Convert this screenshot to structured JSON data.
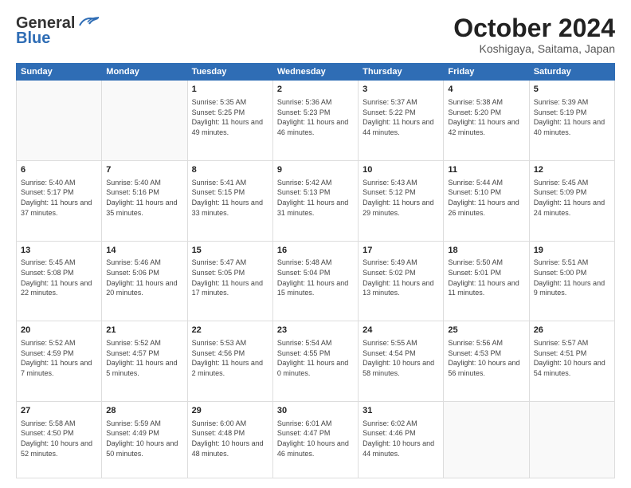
{
  "logo": {
    "line1": "General",
    "line2": "Blue"
  },
  "title": "October 2024",
  "location": "Koshigaya, Saitama, Japan",
  "days_of_week": [
    "Sunday",
    "Monday",
    "Tuesday",
    "Wednesday",
    "Thursday",
    "Friday",
    "Saturday"
  ],
  "weeks": [
    [
      {
        "day": "",
        "detail": ""
      },
      {
        "day": "",
        "detail": ""
      },
      {
        "day": "1",
        "detail": "Sunrise: 5:35 AM\nSunset: 5:25 PM\nDaylight: 11 hours\nand 49 minutes."
      },
      {
        "day": "2",
        "detail": "Sunrise: 5:36 AM\nSunset: 5:23 PM\nDaylight: 11 hours\nand 46 minutes."
      },
      {
        "day": "3",
        "detail": "Sunrise: 5:37 AM\nSunset: 5:22 PM\nDaylight: 11 hours\nand 44 minutes."
      },
      {
        "day": "4",
        "detail": "Sunrise: 5:38 AM\nSunset: 5:20 PM\nDaylight: 11 hours\nand 42 minutes."
      },
      {
        "day": "5",
        "detail": "Sunrise: 5:39 AM\nSunset: 5:19 PM\nDaylight: 11 hours\nand 40 minutes."
      }
    ],
    [
      {
        "day": "6",
        "detail": "Sunrise: 5:40 AM\nSunset: 5:17 PM\nDaylight: 11 hours\nand 37 minutes."
      },
      {
        "day": "7",
        "detail": "Sunrise: 5:40 AM\nSunset: 5:16 PM\nDaylight: 11 hours\nand 35 minutes."
      },
      {
        "day": "8",
        "detail": "Sunrise: 5:41 AM\nSunset: 5:15 PM\nDaylight: 11 hours\nand 33 minutes."
      },
      {
        "day": "9",
        "detail": "Sunrise: 5:42 AM\nSunset: 5:13 PM\nDaylight: 11 hours\nand 31 minutes."
      },
      {
        "day": "10",
        "detail": "Sunrise: 5:43 AM\nSunset: 5:12 PM\nDaylight: 11 hours\nand 29 minutes."
      },
      {
        "day": "11",
        "detail": "Sunrise: 5:44 AM\nSunset: 5:10 PM\nDaylight: 11 hours\nand 26 minutes."
      },
      {
        "day": "12",
        "detail": "Sunrise: 5:45 AM\nSunset: 5:09 PM\nDaylight: 11 hours\nand 24 minutes."
      }
    ],
    [
      {
        "day": "13",
        "detail": "Sunrise: 5:45 AM\nSunset: 5:08 PM\nDaylight: 11 hours\nand 22 minutes."
      },
      {
        "day": "14",
        "detail": "Sunrise: 5:46 AM\nSunset: 5:06 PM\nDaylight: 11 hours\nand 20 minutes."
      },
      {
        "day": "15",
        "detail": "Sunrise: 5:47 AM\nSunset: 5:05 PM\nDaylight: 11 hours\nand 17 minutes."
      },
      {
        "day": "16",
        "detail": "Sunrise: 5:48 AM\nSunset: 5:04 PM\nDaylight: 11 hours\nand 15 minutes."
      },
      {
        "day": "17",
        "detail": "Sunrise: 5:49 AM\nSunset: 5:02 PM\nDaylight: 11 hours\nand 13 minutes."
      },
      {
        "day": "18",
        "detail": "Sunrise: 5:50 AM\nSunset: 5:01 PM\nDaylight: 11 hours\nand 11 minutes."
      },
      {
        "day": "19",
        "detail": "Sunrise: 5:51 AM\nSunset: 5:00 PM\nDaylight: 11 hours\nand 9 minutes."
      }
    ],
    [
      {
        "day": "20",
        "detail": "Sunrise: 5:52 AM\nSunset: 4:59 PM\nDaylight: 11 hours\nand 7 minutes."
      },
      {
        "day": "21",
        "detail": "Sunrise: 5:52 AM\nSunset: 4:57 PM\nDaylight: 11 hours\nand 5 minutes."
      },
      {
        "day": "22",
        "detail": "Sunrise: 5:53 AM\nSunset: 4:56 PM\nDaylight: 11 hours\nand 2 minutes."
      },
      {
        "day": "23",
        "detail": "Sunrise: 5:54 AM\nSunset: 4:55 PM\nDaylight: 11 hours\nand 0 minutes."
      },
      {
        "day": "24",
        "detail": "Sunrise: 5:55 AM\nSunset: 4:54 PM\nDaylight: 10 hours\nand 58 minutes."
      },
      {
        "day": "25",
        "detail": "Sunrise: 5:56 AM\nSunset: 4:53 PM\nDaylight: 10 hours\nand 56 minutes."
      },
      {
        "day": "26",
        "detail": "Sunrise: 5:57 AM\nSunset: 4:51 PM\nDaylight: 10 hours\nand 54 minutes."
      }
    ],
    [
      {
        "day": "27",
        "detail": "Sunrise: 5:58 AM\nSunset: 4:50 PM\nDaylight: 10 hours\nand 52 minutes."
      },
      {
        "day": "28",
        "detail": "Sunrise: 5:59 AM\nSunset: 4:49 PM\nDaylight: 10 hours\nand 50 minutes."
      },
      {
        "day": "29",
        "detail": "Sunrise: 6:00 AM\nSunset: 4:48 PM\nDaylight: 10 hours\nand 48 minutes."
      },
      {
        "day": "30",
        "detail": "Sunrise: 6:01 AM\nSunset: 4:47 PM\nDaylight: 10 hours\nand 46 minutes."
      },
      {
        "day": "31",
        "detail": "Sunrise: 6:02 AM\nSunset: 4:46 PM\nDaylight: 10 hours\nand 44 minutes."
      },
      {
        "day": "",
        "detail": ""
      },
      {
        "day": "",
        "detail": ""
      }
    ]
  ]
}
